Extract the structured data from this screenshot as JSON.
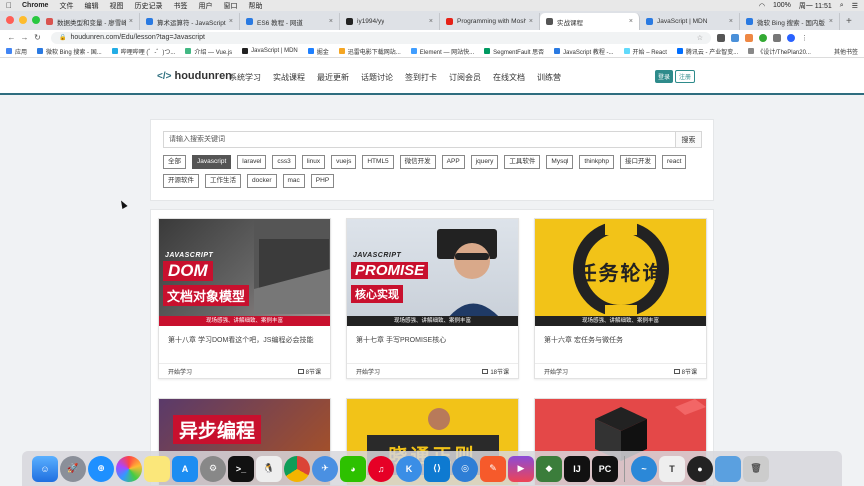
{
  "menubar": {
    "app": "Chrome",
    "items": [
      "文件",
      "编辑",
      "视图",
      "历史记录",
      "书签",
      "用户",
      "窗口",
      "帮助"
    ],
    "battery": "100%",
    "clock": "周一 11:51"
  },
  "tabs": [
    {
      "label": "数据类型和变量 - 廖雪峰的官网",
      "color": "#d9534f"
    },
    {
      "label": "算术运算符 - JavaScript 教程",
      "color": "#2a7ae2"
    },
    {
      "label": "ES6 教程 - 网道",
      "color": "#2a7ae2"
    },
    {
      "label": "iy1994/yy",
      "color": "#222"
    },
    {
      "label": "Programming with Mosh - YouTube",
      "color": "#e62117"
    },
    {
      "label": "实战课程",
      "color": "#555",
      "active": true
    },
    {
      "label": "JavaScript | MDN",
      "color": "#2a7ae2"
    },
    {
      "label": "微软 Bing 搜索 - 国内版",
      "color": "#2a7ae2"
    }
  ],
  "address": "houdunren.com/Edu/lesson?tag=Javascript",
  "bookmarks": [
    {
      "label": "应用",
      "color": "#4285f4"
    },
    {
      "label": "微软 Bing 搜索 - 国...",
      "color": "#2a7ae2"
    },
    {
      "label": "哔哩哔哩 (゜-゜)つ...",
      "color": "#23ade5"
    },
    {
      "label": "介绍 — Vue.js",
      "color": "#42b883"
    },
    {
      "label": "JavaScript | MDN",
      "color": "#222"
    },
    {
      "label": "掘金",
      "color": "#1e80ff"
    },
    {
      "label": "迅雷电影下载网站...",
      "color": "#f5a623"
    },
    {
      "label": "Element — 网站快...",
      "color": "#409eff"
    },
    {
      "label": "SegmentFault 思否",
      "color": "#009a61"
    },
    {
      "label": "JavaScript 教程 -...",
      "color": "#2a7ae2"
    },
    {
      "label": "开始 – React",
      "color": "#61dafb"
    },
    {
      "label": "腾讯云 - 产业智变...",
      "color": "#006eff"
    },
    {
      "label": "《设计/ThePlan20...",
      "color": "#888"
    }
  ],
  "bookmarks_other": "其他书签",
  "site": {
    "logo": "houdunren",
    "nav": [
      "系统学习",
      "实战课程",
      "最近更新",
      "话题讨论",
      "签到打卡",
      "订阅会员",
      "在线文档",
      "训练营"
    ],
    "login": "登录",
    "register": "注册"
  },
  "search": {
    "placeholder": "请输入搜索关键词",
    "button": "搜索"
  },
  "tags": [
    "全部",
    "Javascript",
    "laravel",
    "css3",
    "linux",
    "vuejs",
    "HTML5",
    "微信开发",
    "APP",
    "jquery",
    "工具软件",
    "Mysql",
    "thinkphp",
    "接口开发",
    "react",
    "开源软件",
    "工作生活",
    "docker",
    "mac",
    "PHP"
  ],
  "active_tag": "Javascript",
  "courses": [
    {
      "title": "第十八章 学习DOM看这个吧，JS编程必会技能",
      "start": "开始学习",
      "lessons": "8节课",
      "thumb_top": "JAVASCRIPT",
      "thumb_big": "DOM",
      "thumb_sub": "文档对象模型",
      "thumb_band": "现场感强、讲解细致、案例丰富"
    },
    {
      "title": "第十七章 手写PROMISE核心",
      "start": "开始学习",
      "lessons": "18节课",
      "thumb_top": "JAVASCRIPT",
      "thumb_big": "PROMISE",
      "thumb_sub": "核心实现",
      "thumb_band": "现场感强、讲解细致、案例丰富"
    },
    {
      "title": "第十六章 宏任务与微任务",
      "start": "开始学习",
      "lessons": "8节课",
      "thumb_big": "任务轮询",
      "thumb_band": "现场感强、讲解细致、案例丰富"
    },
    {
      "thumb_big": "异步编程"
    },
    {
      "thumb_big": "晓通正则"
    },
    {
      "thumb_big": ""
    }
  ],
  "colors": {
    "brand": "#2e8b8b",
    "header_border": "#2e6d7f",
    "red_band": "#c8102e"
  }
}
